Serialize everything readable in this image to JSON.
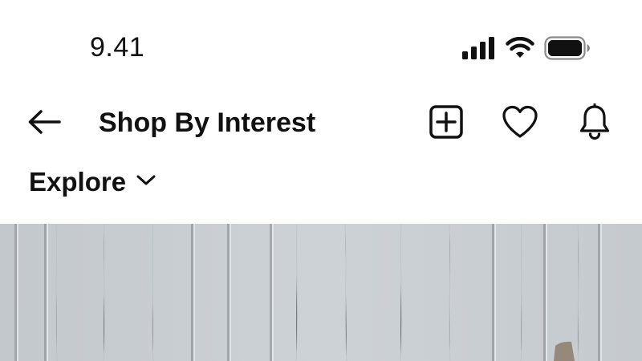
{
  "status_bar": {
    "time": "9.41",
    "icons": [
      "cellular-signal-icon",
      "wifi-icon",
      "battery-icon"
    ]
  },
  "app_bar": {
    "title": "Shop By Interest",
    "back_icon": "back-arrow-icon",
    "actions": [
      {
        "name": "add-post-button",
        "icon": "plus-square-icon"
      },
      {
        "name": "favorites-button",
        "icon": "heart-icon"
      },
      {
        "name": "notifications-button",
        "icon": "bell-icon"
      }
    ]
  },
  "explore": {
    "label": "Explore",
    "icon": "chevron-down-icon"
  },
  "hero": {
    "image": "white wooden wall panels",
    "colors": {
      "panel": "#c8cdd1",
      "groove": "#9ea4a9",
      "highlight": "#e3e6e9"
    }
  }
}
